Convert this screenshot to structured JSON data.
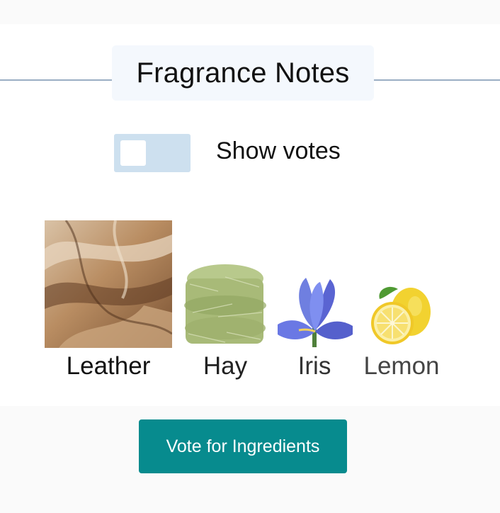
{
  "section": {
    "title": "Fragrance Notes"
  },
  "toggle": {
    "label": "Show votes",
    "checked": false
  },
  "notes": [
    {
      "name": "Leather",
      "icon": "leather-image",
      "label_color": "#111111"
    },
    {
      "name": "Hay",
      "icon": "hay-image",
      "label_color": "#222222"
    },
    {
      "name": "Iris",
      "icon": "iris-flower-image",
      "label_color": "#333333"
    },
    {
      "name": "Lemon",
      "icon": "lemon-image",
      "label_color": "#444444"
    }
  ],
  "vote_button": {
    "label": "Vote for Ingredients",
    "color": "#078b8e"
  }
}
